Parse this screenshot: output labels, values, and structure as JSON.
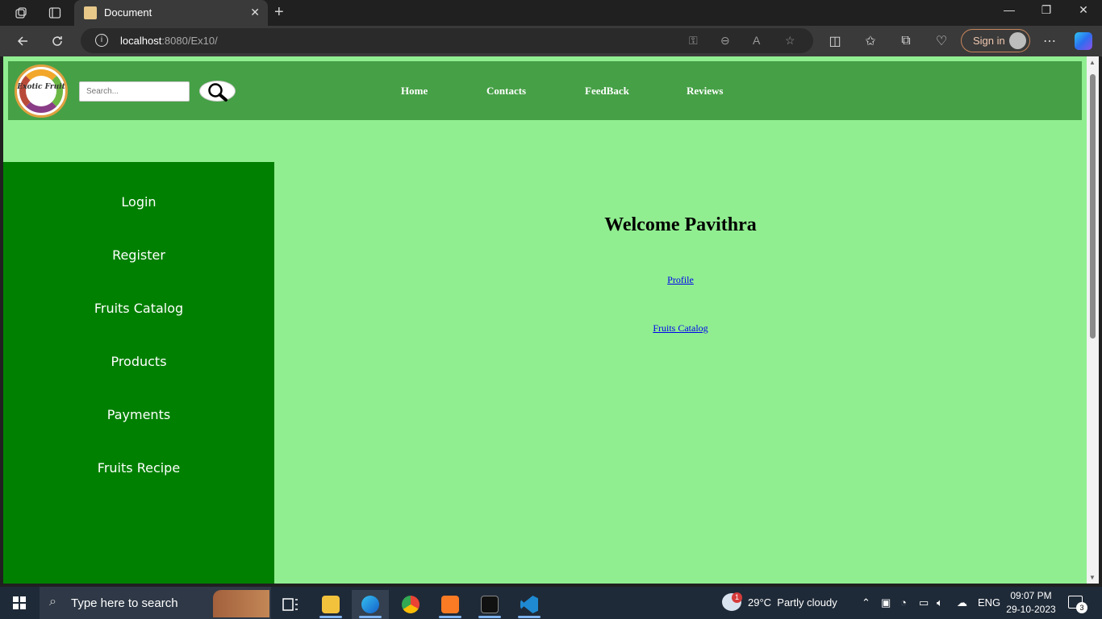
{
  "browser": {
    "tab_title": "Document",
    "url_host": "localhost",
    "url_rest": ":8080/Ex10/",
    "sign_in": "Sign in"
  },
  "site": {
    "logo_text": "Exotic Fruit",
    "search_placeholder": "Search...",
    "nav": [
      "Home",
      "Contacts",
      "FeedBack",
      "Reviews"
    ],
    "sidebar": [
      "Login",
      "Register",
      "Fruits Catalog",
      "Products",
      "Payments",
      "Fruits Recipe"
    ],
    "welcome": "Welcome Pavithra",
    "links": [
      "Profile",
      "Fruits Catalog"
    ]
  },
  "taskbar": {
    "search_placeholder": "Type here to search",
    "weather": "29°C  Partly cloudy",
    "weather_badge": "1",
    "lang": "ENG",
    "time": "09:07 PM",
    "date": "29-10-2023",
    "notifications": "3"
  }
}
